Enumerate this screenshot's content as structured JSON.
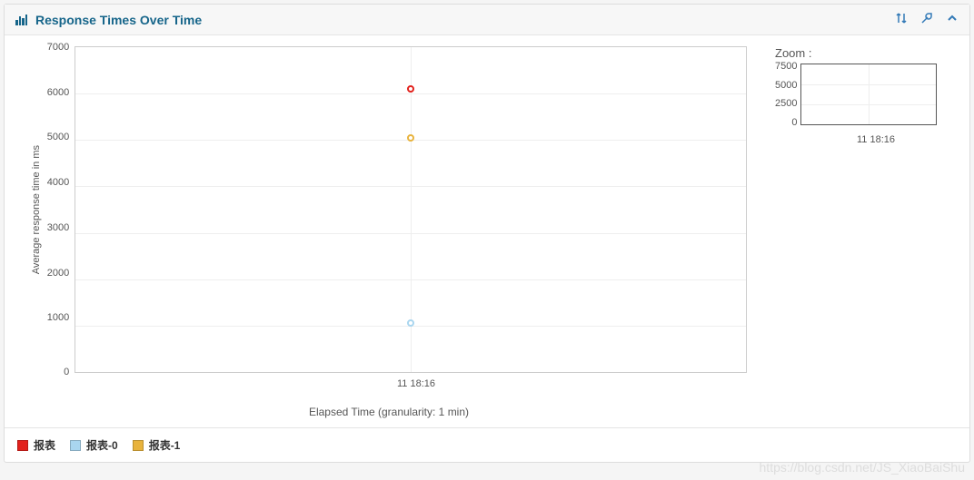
{
  "header": {
    "title": "Response Times Over Time",
    "brand_color": "#16658a",
    "action_color": "#337ab7"
  },
  "chart_data": {
    "type": "scatter",
    "title": "",
    "xlabel": "Elapsed Time (granularity: 1 min)",
    "ylabel": "Average response time in ms",
    "ylim": [
      0,
      7000
    ],
    "xlim_labels": [
      "11 18:16"
    ],
    "y_ticks": [
      7000,
      6000,
      5000,
      4000,
      3000,
      2000,
      1000,
      0
    ],
    "x_ticks": [
      "11 18:16"
    ],
    "series": [
      {
        "name": "报表",
        "color": "#e2211c",
        "x": [
          "11 18:16"
        ],
        "values": [
          6100
        ]
      },
      {
        "name": "报表-0",
        "color": "#a9d6ef",
        "x": [
          "11 18:16"
        ],
        "values": [
          1050
        ]
      },
      {
        "name": "报表-1",
        "color": "#e8b33d",
        "x": [
          "11 18:16"
        ],
        "values": [
          5050
        ]
      }
    ]
  },
  "zoom": {
    "title": "Zoom :",
    "y_ticks": [
      7500,
      5000,
      2500,
      0
    ],
    "x_ticks": [
      "11 18:16"
    ]
  },
  "legend": {
    "items": [
      {
        "label": "报表",
        "color": "#e2211c"
      },
      {
        "label": "报表-0",
        "color": "#a9d6ef"
      },
      {
        "label": "报表-1",
        "color": "#e8b33d"
      }
    ]
  },
  "watermark": "https://blog.csdn.net/JS_XiaoBaiShu"
}
